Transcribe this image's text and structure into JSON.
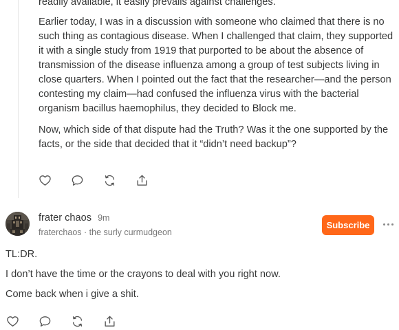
{
  "parent_comment": {
    "paragraphs": [
      "readily available, it easily prevails against challenges.",
      "Earlier today, I was in a discussion with someone who claimed that there is no such thing as contagious disease. When I challenged that claim, they supported it with a single study from 1919 that purported to be about the absence of transmission of the disease influenza among a group of test subjects living in close quarters. When I pointed out the fact that the researcher—and the person contesting my claim—had confused the influenza virus with the bacterial organism bacillus haemophilus, they decided to Block me.",
      "Now, which side of that dispute had the Truth? Was it the one supported by the facts, or the side that decided that it “didn’t need backup”?"
    ],
    "actions": [
      "heart-icon",
      "comment-icon",
      "restack-icon",
      "share-icon"
    ]
  },
  "reply_comment": {
    "author": "frater chaos",
    "time": "9m",
    "handle": "fraterchaos",
    "tagline": "the surly curmudgeon",
    "handle_line": "fraterchaos · the surly curmudgeon",
    "subscribe_label": "Subscribe",
    "paragraphs": [
      "TL:DR.",
      "I don’t have the time or the crayons to deal with you right now.",
      "Come back when i give a shit."
    ],
    "actions": [
      "heart-icon",
      "comment-icon",
      "restack-icon",
      "share-icon"
    ]
  },
  "colors": {
    "subscribe_bg": "#ff6719",
    "text": "#363737",
    "muted": "#777777",
    "icon": "#555555"
  }
}
